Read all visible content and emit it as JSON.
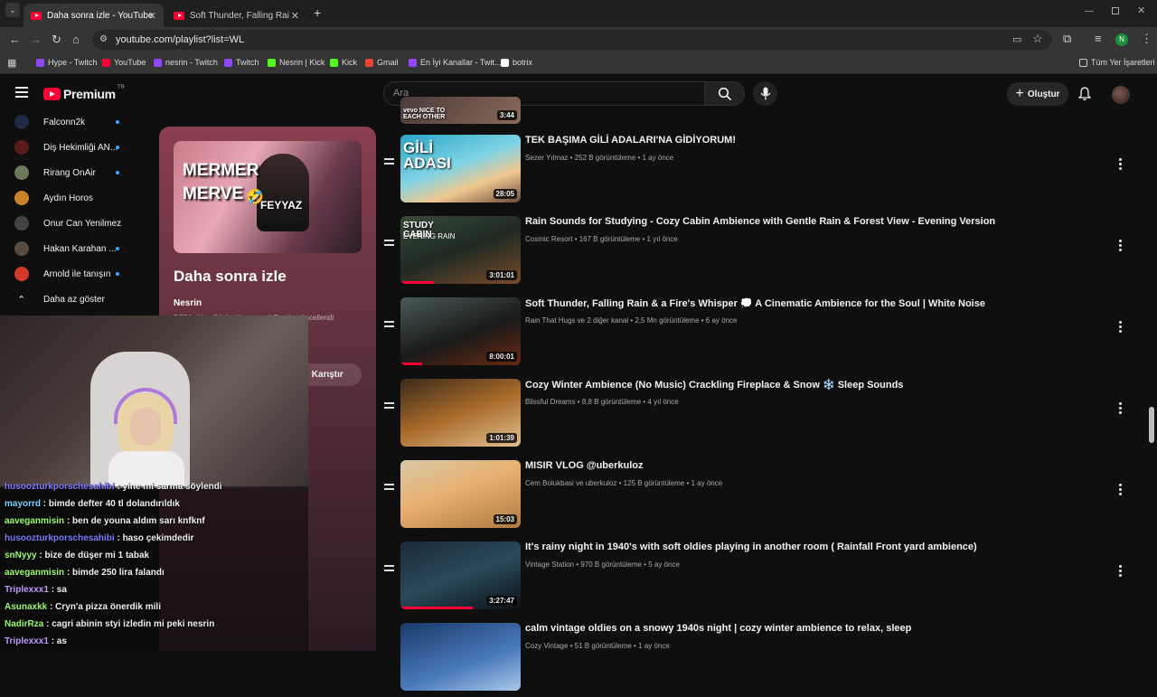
{
  "browser": {
    "tabs": [
      {
        "label": "Daha sonra izle - YouTube"
      },
      {
        "label": "Soft Thunder, Falling Rain & a Fi"
      }
    ],
    "url": "youtube.com/playlist?list=WL",
    "bookmarks": [
      {
        "label": "Hype - Twitch",
        "color": "#9146ff"
      },
      {
        "label": "YouTube",
        "color": "#ff0033"
      },
      {
        "label": "nesrin - Twitch",
        "color": "#9146ff"
      },
      {
        "label": "Twitch",
        "color": "#9146ff"
      },
      {
        "label": "Nesrin | Kick",
        "color": "#53fc18"
      },
      {
        "label": "Kick",
        "color": "#53fc18"
      },
      {
        "label": "Gmail",
        "color": "#ea4335"
      },
      {
        "label": "En İyi Kanallar - Twit...",
        "color": "#9146ff"
      },
      {
        "label": "botrix",
        "color": "#ffffff"
      }
    ],
    "all_bookmarks": "Tüm Yer İşaretleri",
    "profile_initial": "N"
  },
  "header": {
    "logo_text": "Premium",
    "logo_region": "TR",
    "search_placeholder": "Ara",
    "create_label": "Oluştur"
  },
  "sidebar": {
    "subscriptions": [
      {
        "name": "Falconn2k",
        "live": true,
        "color": "#1f2a44"
      },
      {
        "name": "Diş Hekimliği AN...",
        "live": true,
        "color": "#5a1a1a"
      },
      {
        "name": "Rirang OnAir",
        "live": true,
        "color": "#6b7a5a"
      },
      {
        "name": "Aydın Horos",
        "live": false,
        "color": "#c9822a"
      },
      {
        "name": "Onur Can Yenilmez",
        "live": false,
        "color": "#444"
      },
      {
        "name": "Hakan Karahan ...",
        "live": true,
        "color": "#5a4a44"
      },
      {
        "name": "Arnold ile tanışın",
        "live": true,
        "color": "#d43a2a"
      }
    ],
    "show_less": "Daha az göster"
  },
  "playlist": {
    "thumb_text_1": "MERMER",
    "thumb_text_2": "MERVE",
    "thumb_text_3": "FEYYAZ",
    "title": "Daha sonra izle",
    "owner": "Nesrin",
    "stats": "5.564 video  Görüntülenme yok  Bugün güncellendi",
    "shuffle_label": "Karıştır"
  },
  "chat": [
    {
      "user": "husoozturkporschesahibi",
      "text": ": yine mi sarma söylendi",
      "color": "#7b7bff"
    },
    {
      "user": "mayorrd",
      "text": ": bimde defter 40 tl dolandırıldık",
      "color": "#7bd3ff"
    },
    {
      "user": "aaveganmisin",
      "text": ": ben de youna aldım sarı knfknf",
      "color": "#9aff6b"
    },
    {
      "user": "husoozturkporschesahibi",
      "text": ": haso çekimdedir",
      "color": "#7b7bff"
    },
    {
      "user": "snNyyy",
      "text": ": bize de düşer mi 1 tabak",
      "color": "#9aff6b"
    },
    {
      "user": "aaveganmisin",
      "text": ": bimde 250 lira falandı",
      "color": "#9aff6b"
    },
    {
      "user": "Triplexxx1",
      "text": ": sa",
      "color": "#c39bff"
    },
    {
      "user": "Asunaxkk",
      "text": ": Cryn'a pizza önerdik mili",
      "color": "#9aff6b"
    },
    {
      "user": "NadirRza",
      "text": ": cagri abinin styi izledin mi peki nesrin",
      "color": "#9aff6b"
    },
    {
      "user": "Triplexxx1",
      "text": ": as",
      "color": "#c39bff"
    }
  ],
  "videos": [
    {
      "title": "",
      "meta": "",
      "duration": "3:44",
      "thumb_text": "vevo NICE TO EACH OTHER",
      "progress": 0
    },
    {
      "title": "TEK BAŞIMA GİLİ ADALARI'NA GİDİYORUM!",
      "meta": "Sezer Yılmaz • 252 B görüntüleme • 1 ay önce",
      "duration": "28:05",
      "thumb_text": "GİLİ ADASI",
      "progress": 0
    },
    {
      "title": "Rain Sounds for Studying - Cozy Cabin Ambience with Gentle Rain & Forest View - Evening Version",
      "meta": "Cosmic Resort • 167 B görüntüleme • 1 yıl önce",
      "duration": "3:01:01",
      "thumb_text": "STUDY CABIN",
      "thumb_sub": "EVENING RAIN",
      "progress": 0.28
    },
    {
      "title": "Soft Thunder, Falling Rain & a Fire's Whisper 💭 A Cinematic Ambience for the Soul | White Noise",
      "meta": "Rain That Hugs ve 2 diğer kanal • 2,5 Mn görüntüleme • 6 ay önce",
      "duration": "8:00:01",
      "thumb_text": "",
      "progress": 0.18
    },
    {
      "title": "Cozy Winter Ambience (No Music) Crackling Fireplace & Snow ❄️ Sleep Sounds",
      "meta": "Blissful Dreams • 8,8 B görüntüleme • 4 yıl önce",
      "duration": "1:01:39",
      "thumb_text": "",
      "progress": 0
    },
    {
      "title": "MISIR VLOG @uberkuloz",
      "meta": "Cem Bolukbasi ve uberkuloz • 125 B görüntüleme • 1 ay önce",
      "duration": "15:03",
      "thumb_text": "",
      "progress": 0
    },
    {
      "title": "It's rainy night in 1940's with soft oldies playing in another room ( Rainfall Front yard ambience)",
      "meta": "Vintage Station • 970 B görüntüleme • 5 ay önce",
      "duration": "3:27:47",
      "thumb_text": "",
      "progress": 0.6
    },
    {
      "title": "calm vintage oldies on a snowy 1940s night | cozy winter ambience to relax, sleep",
      "meta": "Cozy Vintage • 51 B görüntüleme • 1 ay önce",
      "duration": "",
      "thumb_text": "",
      "progress": 0
    }
  ]
}
